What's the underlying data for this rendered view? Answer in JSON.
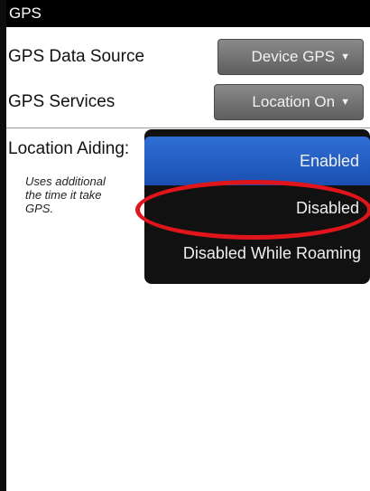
{
  "header": {
    "title": "GPS"
  },
  "settings": {
    "gps_data_source": {
      "label": "GPS Data Source",
      "value": "Device GPS"
    },
    "gps_services": {
      "label": "GPS Services",
      "value": "Location On"
    },
    "location_aiding": {
      "label": "Location Aiding:",
      "description": "Uses additional\nthe time it take\nGPS."
    }
  },
  "popup_menu": {
    "options": [
      "Enabled",
      "Disabled",
      "Disabled While Roaming"
    ],
    "selected": "Enabled",
    "circled": "Disabled"
  },
  "icons": {
    "dropdown": "triangle-down-icon"
  },
  "colors": {
    "accent_selected": "#2f6fd6",
    "annotation_ring": "#e0141b"
  }
}
